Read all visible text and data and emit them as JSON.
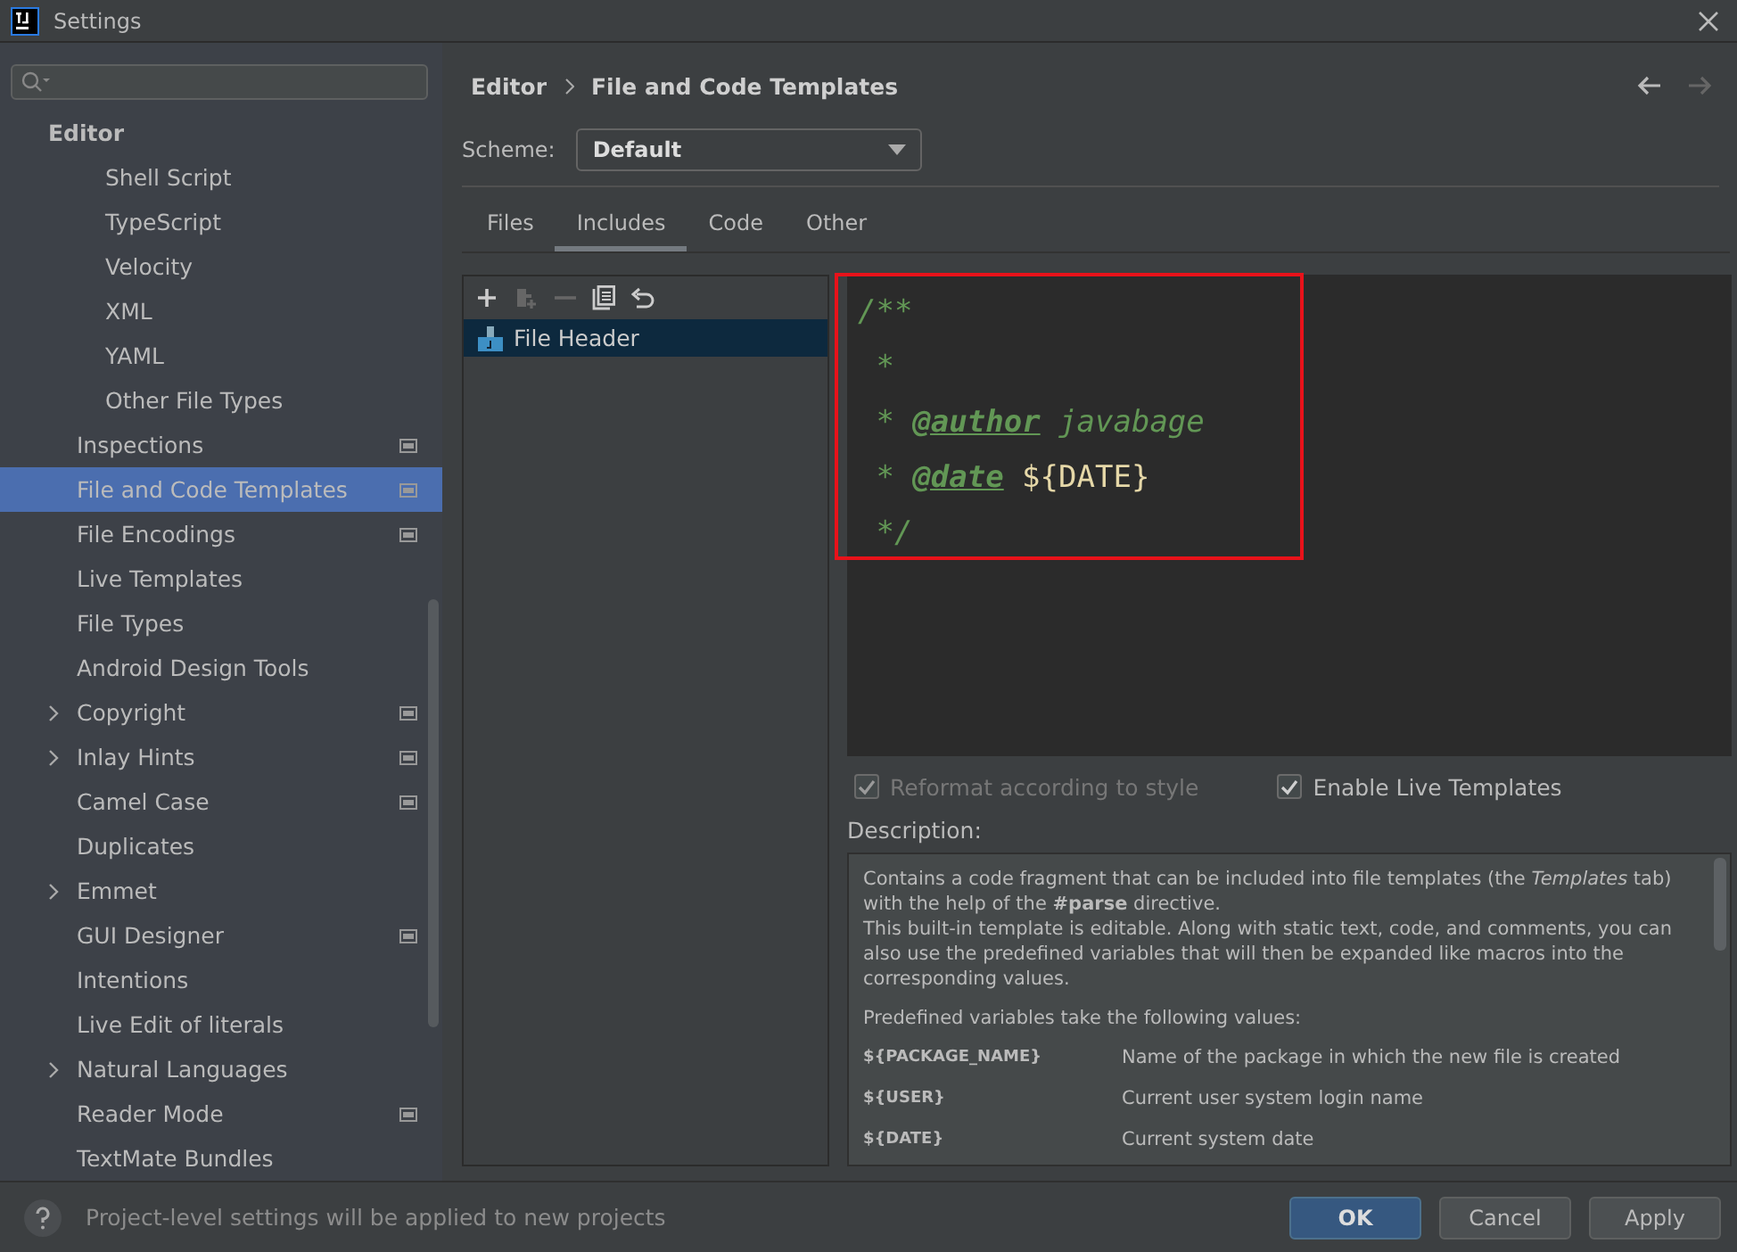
{
  "window": {
    "title": "Settings"
  },
  "sidebar": {
    "items": [
      {
        "label": "Editor",
        "bold": true,
        "children": [
          {
            "children": [
              {
                "label": "Shell Script"
              },
              {
                "label": "TypeScript"
              },
              {
                "label": "Velocity"
              },
              {
                "label": "XML"
              },
              {
                "label": "YAML"
              },
              {
                "label": "Other File Types"
              }
            ]
          },
          {
            "label": "Inspections",
            "selected": false,
            "expandable": false,
            "project": true
          },
          {
            "label": "File and Code Templates",
            "selected": true,
            "expandable": false,
            "project": true
          },
          {
            "label": "File Encodings",
            "selected": false,
            "expandable": false,
            "project": true
          },
          {
            "label": "Live Templates",
            "selected": false,
            "expandable": false,
            "project": false
          },
          {
            "label": "File Types",
            "selected": false,
            "expandable": false,
            "project": false
          },
          {
            "label": "Android Design Tools",
            "selected": false,
            "expandable": false,
            "project": false
          },
          {
            "label": "Copyright",
            "selected": false,
            "expandable": true,
            "project": true
          },
          {
            "label": "Inlay Hints",
            "selected": false,
            "expandable": true,
            "project": true
          },
          {
            "label": "Camel Case",
            "selected": false,
            "expandable": false,
            "project": true
          },
          {
            "label": "Duplicates",
            "selected": false,
            "expandable": false,
            "project": false
          },
          {
            "label": "Emmet",
            "selected": false,
            "expandable": true,
            "project": false
          },
          {
            "label": "GUI Designer",
            "selected": false,
            "expandable": false,
            "project": true
          },
          {
            "label": "Intentions",
            "selected": false,
            "expandable": false,
            "project": false
          },
          {
            "label": "Live Edit of literals",
            "selected": false,
            "expandable": false,
            "project": false
          },
          {
            "label": "Natural Languages",
            "selected": false,
            "expandable": true,
            "project": false
          },
          {
            "label": "Reader Mode",
            "selected": false,
            "expandable": false,
            "project": true
          },
          {
            "label": "TextMate Bundles",
            "selected": false,
            "expandable": false,
            "project": false
          }
        ]
      }
    ]
  },
  "breadcrumb": [
    "Editor",
    "File and Code Templates"
  ],
  "scheme": {
    "label": "Scheme:",
    "value": "Default"
  },
  "tabs": [
    {
      "label": "Files",
      "selected": false
    },
    {
      "label": "Includes",
      "selected": true
    },
    {
      "label": "Code",
      "selected": false
    },
    {
      "label": "Other",
      "selected": false
    }
  ],
  "template_list": {
    "items": [
      {
        "label": "File Header",
        "selected": true
      }
    ]
  },
  "editor": {
    "lines": [
      [
        {
          "kind": "comment",
          "text": "/**"
        }
      ],
      [
        {
          "kind": "comment",
          "text": " *"
        }
      ],
      [
        {
          "kind": "comment",
          "text": " *"
        },
        {
          "kind": "tag",
          "text": "@author"
        },
        {
          "kind": "comment",
          "text": "javabage"
        }
      ],
      [
        {
          "kind": "comment",
          "text": " *"
        },
        {
          "kind": "tag",
          "text": "@date"
        },
        {
          "kind": "variable",
          "text": "${DATE}"
        }
      ],
      [
        {
          "kind": "comment",
          "text": " */"
        }
      ]
    ]
  },
  "options": [
    {
      "label": "Reformat according to style",
      "checked": true,
      "disabled": true
    },
    {
      "label": "Enable Live Templates",
      "checked": true,
      "disabled": false
    }
  ],
  "description": {
    "label": "Description:",
    "paragraphs": [
      "Contains a code fragment that can be included into file templates (the *Templates* tab) with the help of the **#parse** directive.\nThis built-in template is editable. Along with static text, code, and comments, you can also use the predefined variables that will then be expanded like macros into the corresponding values.",
      "Predefined variables take the following values:"
    ],
    "variables": [
      {
        "name": "${PACKAGE_NAME}",
        "meaning": "Name of the package in which the new file is created"
      },
      {
        "name": "${USER}",
        "meaning": "Current user system login name"
      },
      {
        "name": "${DATE}",
        "meaning": "Current system date"
      }
    ]
  },
  "status_bar": {
    "text": "Project-level settings will be applied to new projects"
  },
  "buttons": [
    {
      "label": "OK",
      "kind": "default"
    },
    {
      "label": "Cancel",
      "kind": "plain"
    },
    {
      "label": "Apply",
      "kind": "plain"
    }
  ]
}
